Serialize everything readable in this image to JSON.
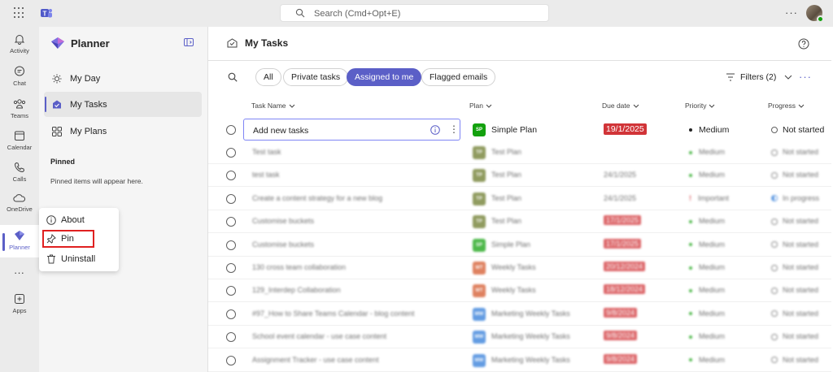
{
  "topbar": {
    "search_placeholder": "Search (Cmd+Opt+E)",
    "more": "···",
    "teams_icon": "teams-logo-icon"
  },
  "rail": {
    "items": [
      {
        "label": "Activity",
        "icon": "bell-icon"
      },
      {
        "label": "Chat",
        "icon": "chat-icon"
      },
      {
        "label": "Teams",
        "icon": "teams-icon"
      },
      {
        "label": "Calendar",
        "icon": "calendar-icon"
      },
      {
        "label": "Calls",
        "icon": "phone-icon"
      },
      {
        "label": "OneDrive",
        "icon": "cloud-icon"
      },
      {
        "label": "Planner",
        "icon": "planner-icon",
        "active": true
      },
      {
        "label": "Apps",
        "icon": "plus-icon"
      }
    ],
    "more": "···"
  },
  "context_menu": {
    "items": [
      {
        "label": "About",
        "icon": "info-icon"
      },
      {
        "label": "Pin",
        "icon": "pin-icon",
        "highlighted": true
      },
      {
        "label": "Uninstall",
        "icon": "trash-icon"
      }
    ]
  },
  "sidebar": {
    "title": "Planner",
    "nav": [
      {
        "label": "My Day",
        "icon": "sun-icon"
      },
      {
        "label": "My Tasks",
        "icon": "tasks-icon",
        "active": true
      },
      {
        "label": "My Plans",
        "icon": "grid-icon"
      }
    ],
    "pinned_heading": "Pinned",
    "pinned_text": "Pinned items will appear here."
  },
  "main": {
    "title": "My Tasks",
    "filters": {
      "pills": [
        "All",
        "Private tasks",
        "Assigned to me",
        "Flagged emails"
      ],
      "selected": "Assigned to me",
      "filters_label": "Filters (2)",
      "more": "···"
    },
    "columns": [
      "Task Name",
      "Plan",
      "Due date",
      "Priority",
      "Progress"
    ],
    "add_row": {
      "placeholder": "Add new tasks",
      "plan": "Simple Plan",
      "plan_abbr": "SP",
      "due": "19/1/2025",
      "priority": "Medium",
      "progress": "Not started"
    },
    "rows": [
      {
        "task": "Test task",
        "plan": "Test Plan",
        "abbr": "TP",
        "plan_color": "#6b7a2a",
        "due": "",
        "due_red": false,
        "priority": "Medium",
        "progress": "Not started"
      },
      {
        "task": "test task",
        "plan": "Test Plan",
        "abbr": "TP",
        "plan_color": "#6b7a2a",
        "due": "24/1/2025",
        "due_red": false,
        "priority": "Medium",
        "progress": "Not started"
      },
      {
        "task": "Create a content strategy for a new blog",
        "plan": "Test Plan",
        "abbr": "TP",
        "plan_color": "#6b7a2a",
        "due": "24/1/2025",
        "due_red": false,
        "priority": "Important",
        "progress": "In progress"
      },
      {
        "task": "Customise buckets",
        "plan": "Test Plan",
        "abbr": "TP",
        "plan_color": "#6b7a2a",
        "due": "17/1/2025",
        "due_red": true,
        "priority": "Medium",
        "progress": "Not started"
      },
      {
        "task": "Customise buckets",
        "plan": "Simple Plan",
        "abbr": "SP",
        "plan_color": "#13a10e",
        "due": "17/1/2025",
        "due_red": true,
        "priority": "Medium",
        "progress": "Not started"
      },
      {
        "task": "130 cross team collaboration",
        "plan": "Weekly Tasks",
        "abbr": "WT",
        "plan_color": "#d4572a",
        "due": "20/12/2024",
        "due_red": true,
        "priority": "Medium",
        "progress": "Not started"
      },
      {
        "task": "129_Interdep Collaboration",
        "plan": "Weekly Tasks",
        "abbr": "WT",
        "plan_color": "#d4572a",
        "due": "18/12/2024",
        "due_red": true,
        "priority": "Medium",
        "progress": "Not started"
      },
      {
        "task": "#97_How to Share Teams Calendar - blog content",
        "plan": "Marketing Weekly Tasks",
        "abbr": "MW",
        "plan_color": "#2f7bd9",
        "due": "9/8/2024",
        "due_red": true,
        "priority": "Medium",
        "progress": "Not started"
      },
      {
        "task": "School event calendar - use case content",
        "plan": "Marketing Weekly Tasks",
        "abbr": "MW",
        "plan_color": "#2f7bd9",
        "due": "9/8/2024",
        "due_red": true,
        "priority": "Medium",
        "progress": "Not started"
      },
      {
        "task": "Assignment Tracker - use case content",
        "plan": "Marketing Weekly Tasks",
        "abbr": "MW",
        "plan_color": "#2f7bd9",
        "due": "9/8/2024",
        "due_red": true,
        "priority": "Medium",
        "progress": "Not started"
      }
    ]
  },
  "colors": {
    "accent": "#5b5fc7",
    "overdue": "#d13438",
    "highlight_box": "#e02020"
  }
}
